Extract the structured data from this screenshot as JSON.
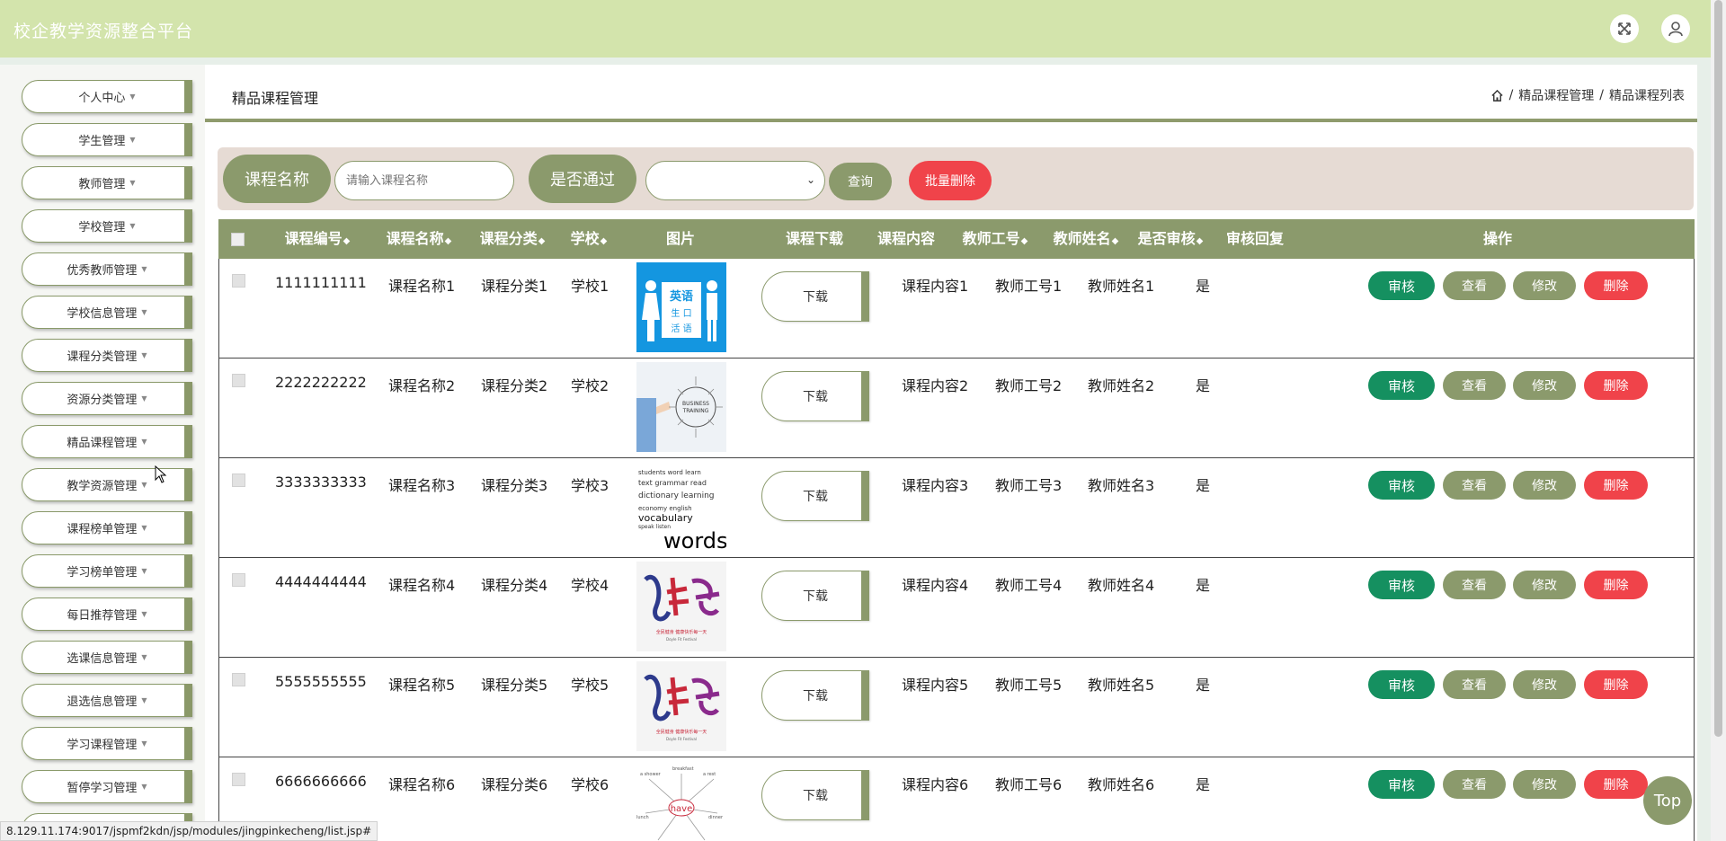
{
  "app": {
    "title": "校企教学资源整合平台"
  },
  "header_icons": {
    "fullscreen": "fullscreen-icon",
    "user": "user-icon"
  },
  "sidebar": {
    "items": [
      {
        "label": "个人中心"
      },
      {
        "label": "学生管理"
      },
      {
        "label": "教师管理"
      },
      {
        "label": "学校管理"
      },
      {
        "label": "优秀教师管理"
      },
      {
        "label": "学校信息管理"
      },
      {
        "label": "课程分类管理"
      },
      {
        "label": "资源分类管理"
      },
      {
        "label": "精品课程管理"
      },
      {
        "label": "教学资源管理"
      },
      {
        "label": "课程榜单管理"
      },
      {
        "label": "学习榜单管理"
      },
      {
        "label": "每日推荐管理"
      },
      {
        "label": "选课信息管理"
      },
      {
        "label": "退选信息管理"
      },
      {
        "label": "学习课程管理"
      },
      {
        "label": "暂停学习管理"
      }
    ]
  },
  "page": {
    "title": "精品课程管理",
    "breadcrumb": [
      "精品课程管理",
      "精品课程列表"
    ],
    "separator": "/"
  },
  "search": {
    "name_label": "课程名称",
    "name_placeholder": "请输入课程名称",
    "pass_label": "是否通过",
    "pass_value": "",
    "query_label": "查询",
    "batch_delete_label": "批量删除"
  },
  "table": {
    "columns": [
      {
        "label": "课程编号",
        "sortable": true
      },
      {
        "label": "课程名称",
        "sortable": true
      },
      {
        "label": "课程分类",
        "sortable": true
      },
      {
        "label": "学校",
        "sortable": true
      },
      {
        "label": "图片",
        "sortable": false
      },
      {
        "label": "课程下载",
        "sortable": false
      },
      {
        "label": "课程内容",
        "sortable": false
      },
      {
        "label": "教师工号",
        "sortable": true
      },
      {
        "label": "教师姓名",
        "sortable": true
      },
      {
        "label": "是否审核",
        "sortable": true
      },
      {
        "label": "审核回复",
        "sortable": false
      },
      {
        "label": "操作",
        "sortable": false
      }
    ],
    "sort_glyph": "◆",
    "download_label": "下载",
    "actions": {
      "audit": "审核",
      "view": "查看",
      "edit": "修改",
      "delete": "删除"
    },
    "rows": [
      {
        "code": "1111111111",
        "name": "课程名称1",
        "category": "课程分类1",
        "school": "学校1",
        "image": "english-speaking-image",
        "content": "课程内容1",
        "teacher_no": "教师工号1",
        "teacher_name": "教师姓名1",
        "audited": "是",
        "reply": ""
      },
      {
        "code": "2222222222",
        "name": "课程名称2",
        "category": "课程分类2",
        "school": "学校2",
        "image": "business-training-image",
        "content": "课程内容2",
        "teacher_no": "教师工号2",
        "teacher_name": "教师姓名2",
        "audited": "是",
        "reply": ""
      },
      {
        "code": "3333333333",
        "name": "课程名称3",
        "category": "课程分类3",
        "school": "学校3",
        "image": "vocabulary-words-image",
        "content": "课程内容3",
        "teacher_no": "教师工号3",
        "teacher_name": "教师姓名3",
        "audited": "是",
        "reply": ""
      },
      {
        "code": "4444444444",
        "name": "课程名称4",
        "category": "课程分类4",
        "school": "学校4",
        "image": "calligraphy-image",
        "content": "课程内容4",
        "teacher_no": "教师工号4",
        "teacher_name": "教师姓名4",
        "audited": "是",
        "reply": ""
      },
      {
        "code": "5555555555",
        "name": "课程名称5",
        "category": "课程分类5",
        "school": "学校5",
        "image": "calligraphy-image",
        "content": "课程内容5",
        "teacher_no": "教师工号5",
        "teacher_name": "教师姓名5",
        "audited": "是",
        "reply": ""
      },
      {
        "code": "6666666666",
        "name": "课程名称6",
        "category": "课程分类6",
        "school": "学校6",
        "image": "have-mindmap-image",
        "content": "课程内容6",
        "teacher_no": "教师工号6",
        "teacher_name": "教师姓名6",
        "audited": "是",
        "reply": ""
      }
    ]
  },
  "top_button": {
    "label": "Top"
  },
  "status_bar": {
    "url": "8.129.11.174:9017/jspmf2kdn/jsp/modules/jingpinkecheng/list.jsp#"
  },
  "colors": {
    "accent": "#8b9a6c",
    "header": "#d3e4ac",
    "danger": "#f0434a",
    "audit": "#159060",
    "search_bg": "#e6dbd4"
  }
}
